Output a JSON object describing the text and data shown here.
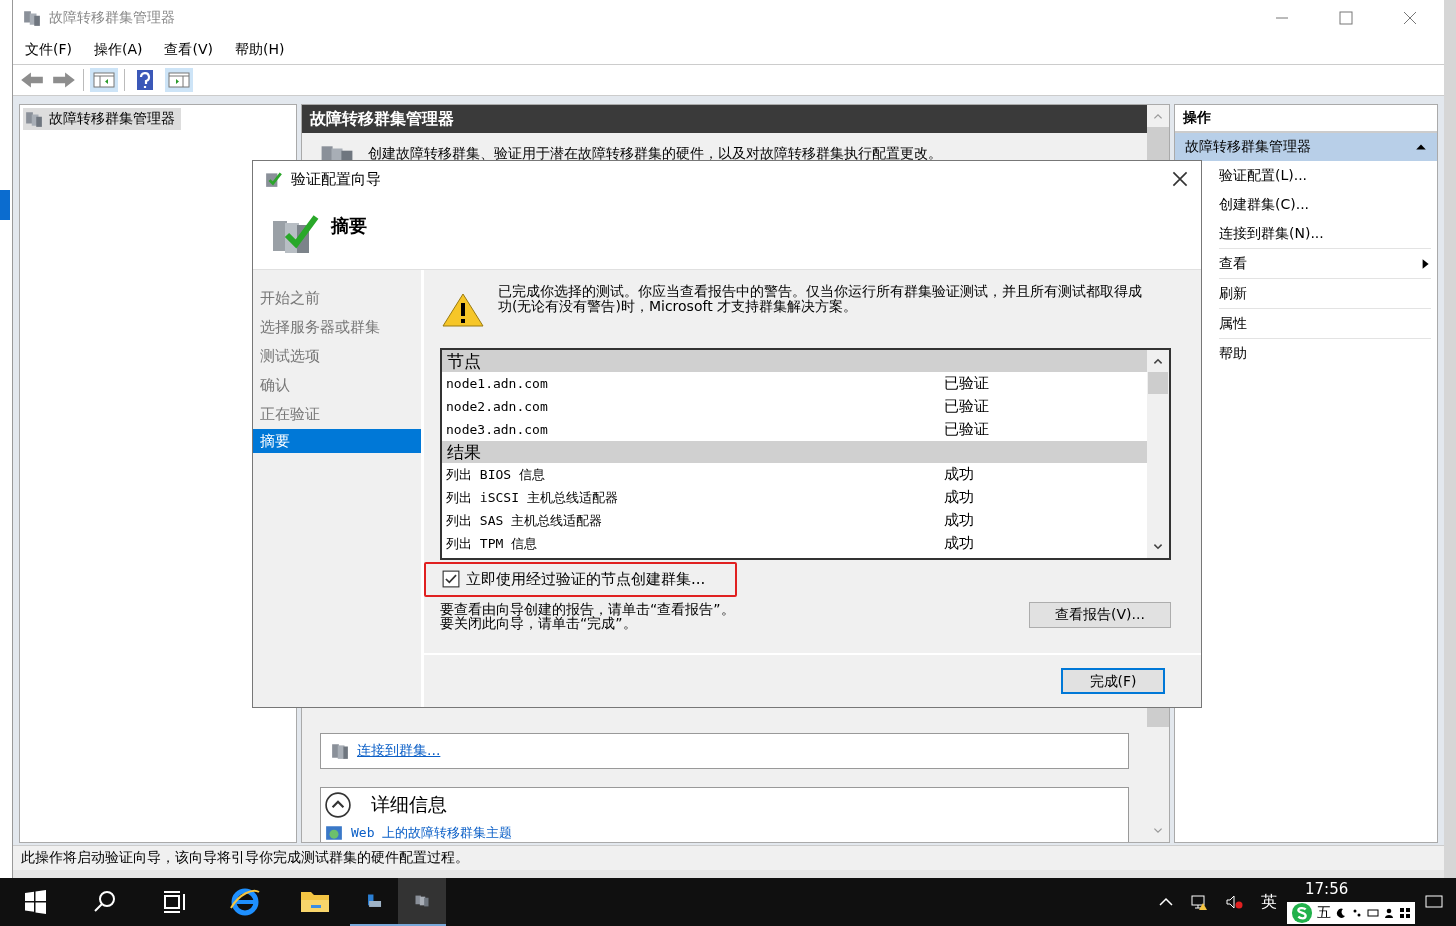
{
  "window": {
    "title": "故障转移群集管理器"
  },
  "menu": [
    "文件(F)",
    "操作(A)",
    "查看(V)",
    "帮助(H)"
  ],
  "tree": {
    "items": [
      {
        "label": "故障转移群集管理器",
        "selected": true
      }
    ]
  },
  "center": {
    "header": "故障转移群集管理器",
    "description": "创建故障转移群集、验证用于潜在故障转移群集的硬件，以及对故障转移群集执行配置更改。",
    "links": [
      "连接到群集..."
    ],
    "details": {
      "title": "详细信息",
      "expanded": true,
      "links": [
        "Web 上的故障转移群集主题"
      ]
    }
  },
  "actions": {
    "title": "操作",
    "group": {
      "label": "故障转移群集管理器",
      "expanded": true
    },
    "items": [
      {
        "label": "验证配置(L)...",
        "kind": "command"
      },
      {
        "label": "创建群集(C)...",
        "kind": "command"
      },
      {
        "label": "连接到群集(N)...",
        "kind": "command"
      },
      {
        "label": "查看",
        "kind": "submenu"
      },
      {
        "label": "刷新",
        "kind": "plain"
      },
      {
        "label": "属性",
        "kind": "plain"
      },
      {
        "label": "帮助",
        "kind": "plain"
      }
    ]
  },
  "status_bar": "此操作将启动验证向导，该向导将引导你完成测试群集的硬件配置过程。",
  "dialog": {
    "title": "验证配置向导",
    "heading": "摘要",
    "steps": [
      {
        "label": "开始之前",
        "selected": false
      },
      {
        "label": "选择服务器或群集",
        "selected": false
      },
      {
        "label": "测试选项",
        "selected": false
      },
      {
        "label": "确认",
        "selected": false
      },
      {
        "label": "正在验证",
        "selected": false
      },
      {
        "label": "摘要",
        "selected": true
      }
    ],
    "warning": "已完成你选择的测试。你应当查看报告中的警告。仅当你运行所有群集验证测试，并且所有测试都取得成功(无论有没有警告)时，Microsoft 才支持群集解决方案。",
    "report": [
      {
        "title": "节点",
        "rows": [
          {
            "name": "node1.adn.com",
            "status": "已验证"
          },
          {
            "name": "node2.adn.com",
            "status": "已验证"
          },
          {
            "name": "node3.adn.com",
            "status": "已验证"
          }
        ]
      },
      {
        "title": "结果",
        "rows": [
          {
            "name": "列出 BIOS 信息",
            "status": "成功"
          },
          {
            "name": "列出 iSCSI 主机总线适配器",
            "status": "成功"
          },
          {
            "name": "列出 SAS 主机总线适配器",
            "status": "成功"
          },
          {
            "name": "列出 TPM 信息",
            "status": "成功"
          }
        ]
      }
    ],
    "checkbox": {
      "label": "立即使用经过验证的节点创建群集...",
      "checked": true,
      "highlighted": true
    },
    "instructions": [
      "要查看由向导创建的报告，请单击“查看报告”。",
      "要关闭此向导，请单击“完成”。"
    ],
    "report_button": "查看报告(V)...",
    "finish_button": "完成(F)"
  },
  "taskbar": {
    "tray_language": "英",
    "time": "17:56",
    "ime_mode": "五"
  }
}
